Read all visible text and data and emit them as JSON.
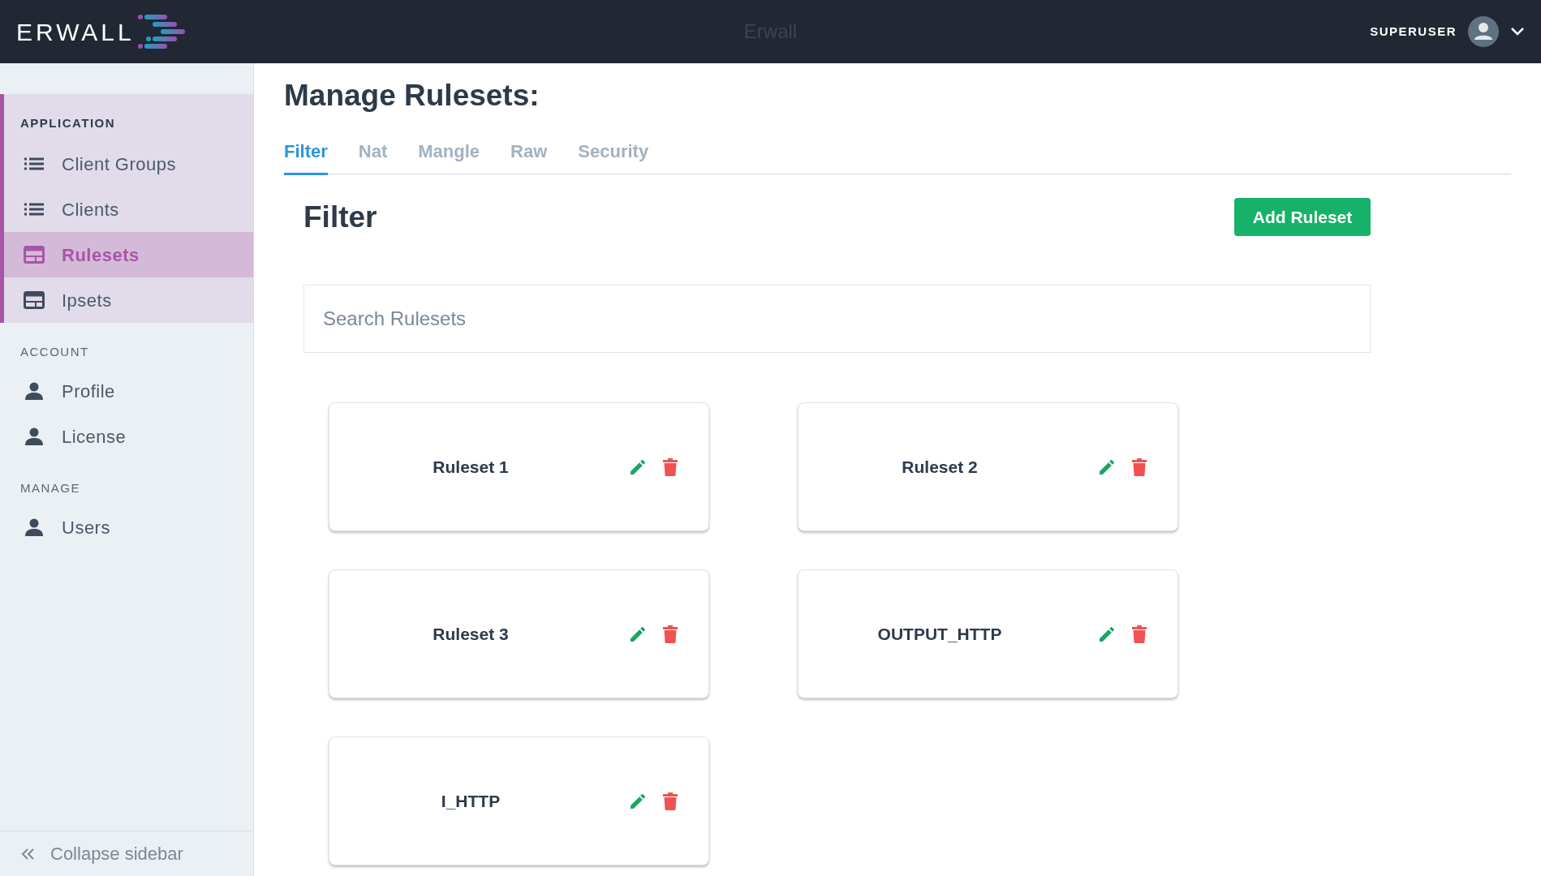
{
  "header": {
    "logo": "ERWALL",
    "title": "Erwall",
    "user": "SUPERUSER"
  },
  "sidebar": {
    "sections": [
      {
        "title": "APPLICATION",
        "active": true,
        "items": [
          {
            "label": "Client Groups",
            "kind": "list",
            "selected": false
          },
          {
            "label": "Clients",
            "kind": "list",
            "selected": false
          },
          {
            "label": "Rulesets",
            "kind": "table",
            "selected": true
          },
          {
            "label": "Ipsets",
            "kind": "table",
            "selected": false
          }
        ]
      },
      {
        "title": "ACCOUNT",
        "active": false,
        "items": [
          {
            "label": "Profile",
            "kind": "person",
            "selected": false
          },
          {
            "label": "License",
            "kind": "person",
            "selected": false
          }
        ]
      },
      {
        "title": "MANAGE",
        "active": false,
        "items": [
          {
            "label": "Users",
            "kind": "person",
            "selected": false
          }
        ]
      }
    ],
    "collapse": "Collapse sidebar"
  },
  "page": {
    "title": "Manage Rulesets:",
    "tabs": [
      {
        "label": "Filter",
        "selected": true
      },
      {
        "label": "Nat",
        "selected": false
      },
      {
        "label": "Mangle",
        "selected": false
      },
      {
        "label": "Raw",
        "selected": false
      },
      {
        "label": "Security",
        "selected": false
      }
    ],
    "heading": "Filter",
    "add_button": "Add Ruleset",
    "search": {
      "placeholder": "Search Rulesets"
    },
    "rulesets": [
      {
        "name": "Ruleset 1"
      },
      {
        "name": "Ruleset 2"
      },
      {
        "name": "Ruleset 3"
      },
      {
        "name": "OUTPUT_HTTP"
      },
      {
        "name": "I_HTTP"
      }
    ]
  }
}
